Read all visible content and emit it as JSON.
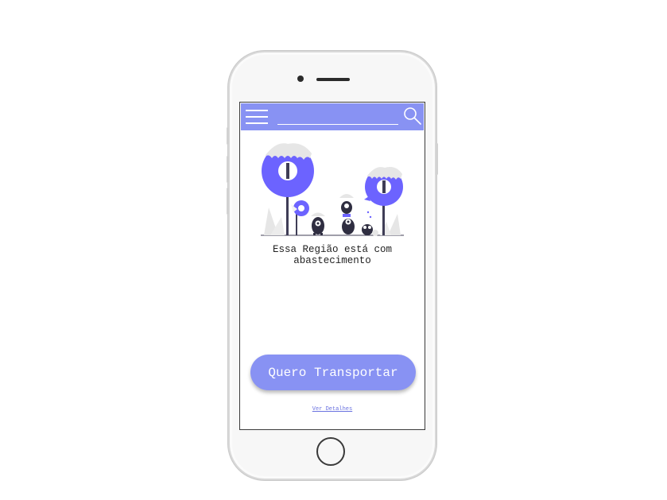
{
  "header": {
    "search_placeholder": "",
    "search_value": ""
  },
  "main": {
    "message": "Essa Região está com abastecimento",
    "primary_button_label": "Quero Transportar",
    "details_link_label": "Ver Detalhes"
  },
  "icons": {
    "menu": "hamburger-menu-icon",
    "search": "magnifier-icon",
    "illustration": "monsters-and-trees-illustration"
  },
  "colors": {
    "accent": "#8892f3",
    "illustration_purple": "#6c63ff",
    "dark": "#2f2e41",
    "text": "#222222"
  }
}
